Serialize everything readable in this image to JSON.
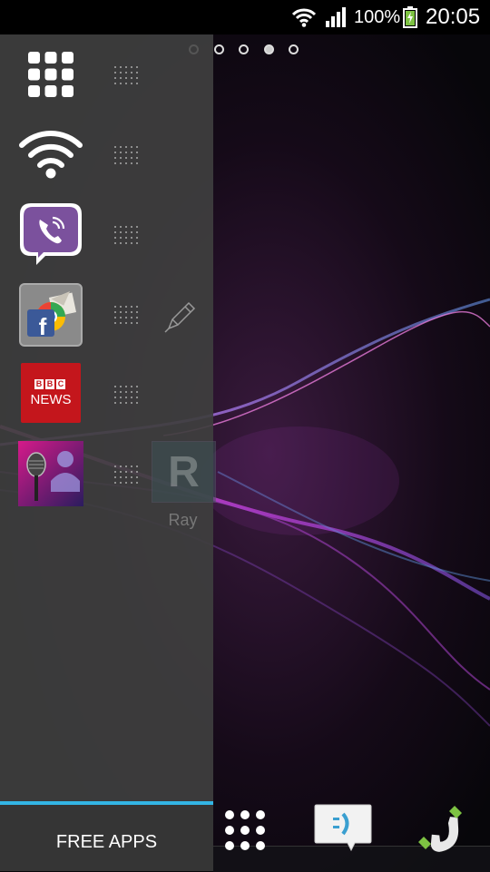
{
  "status_bar": {
    "battery_percent": "100%",
    "time": "20:05",
    "icons": [
      "wifi-icon",
      "signal-icon",
      "battery-charging-icon"
    ]
  },
  "home": {
    "page_count": 5,
    "current_page": 4
  },
  "drawer": {
    "apps": [
      {
        "name": "app-grid-icon"
      },
      {
        "name": "wifi-widget-icon"
      },
      {
        "name": "viber-icon"
      },
      {
        "name": "facebook-folder-icon"
      },
      {
        "name": "bbc-news-icon",
        "text_line1": "BBC",
        "text_line2": "NEWS"
      },
      {
        "name": "karaoke-icon"
      }
    ],
    "footer_label": "FREE APPS"
  },
  "dragging_item": {
    "letter": "R",
    "label": "Ray"
  },
  "dock": {
    "items": [
      "apps-button",
      "messaging-icon",
      "phone-icon"
    ]
  },
  "colors": {
    "accent": "#33b5e5",
    "viber": "#7b519d",
    "bbc_red": "#c4161c",
    "facebook": "#3b5998"
  }
}
